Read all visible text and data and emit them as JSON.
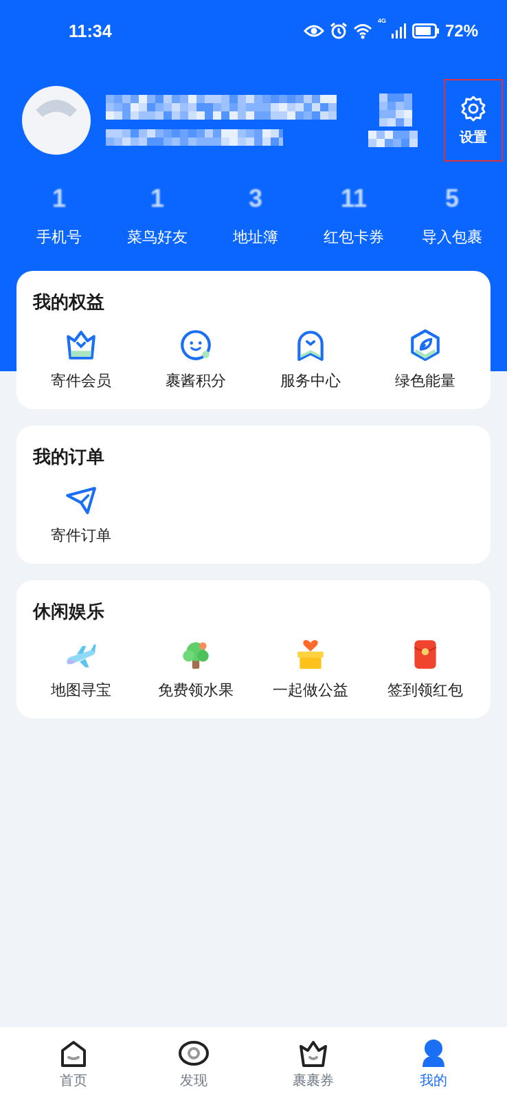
{
  "status_bar": {
    "time": "11:34",
    "network": "4G",
    "battery": "72%"
  },
  "profile": {
    "settings": {
      "label": "设置",
      "highlighted": true
    }
  },
  "stats": [
    {
      "count": "1",
      "label": "手机号"
    },
    {
      "count": "1",
      "label": "菜鸟好友"
    },
    {
      "count": "3",
      "label": "地址簿"
    },
    {
      "count": "11",
      "label": "红包卡券"
    },
    {
      "count": "5",
      "label": "导入包裹"
    }
  ],
  "sections": [
    {
      "title": "我的权益",
      "items": [
        "寄件会员",
        "裹酱积分",
        "服务中心",
        "绿色能量"
      ]
    },
    {
      "title": "我的订单",
      "items": [
        "寄件订单"
      ]
    },
    {
      "title": "休闲娱乐",
      "items": [
        "地图寻宝",
        "免费领水果",
        "一起做公益",
        "签到领红包"
      ]
    }
  ],
  "tab_bar": [
    {
      "label": "首页",
      "selected": false
    },
    {
      "label": "发现",
      "selected": false
    },
    {
      "label": "裹裹券",
      "selected": false
    },
    {
      "label": "我的",
      "selected": true
    }
  ]
}
